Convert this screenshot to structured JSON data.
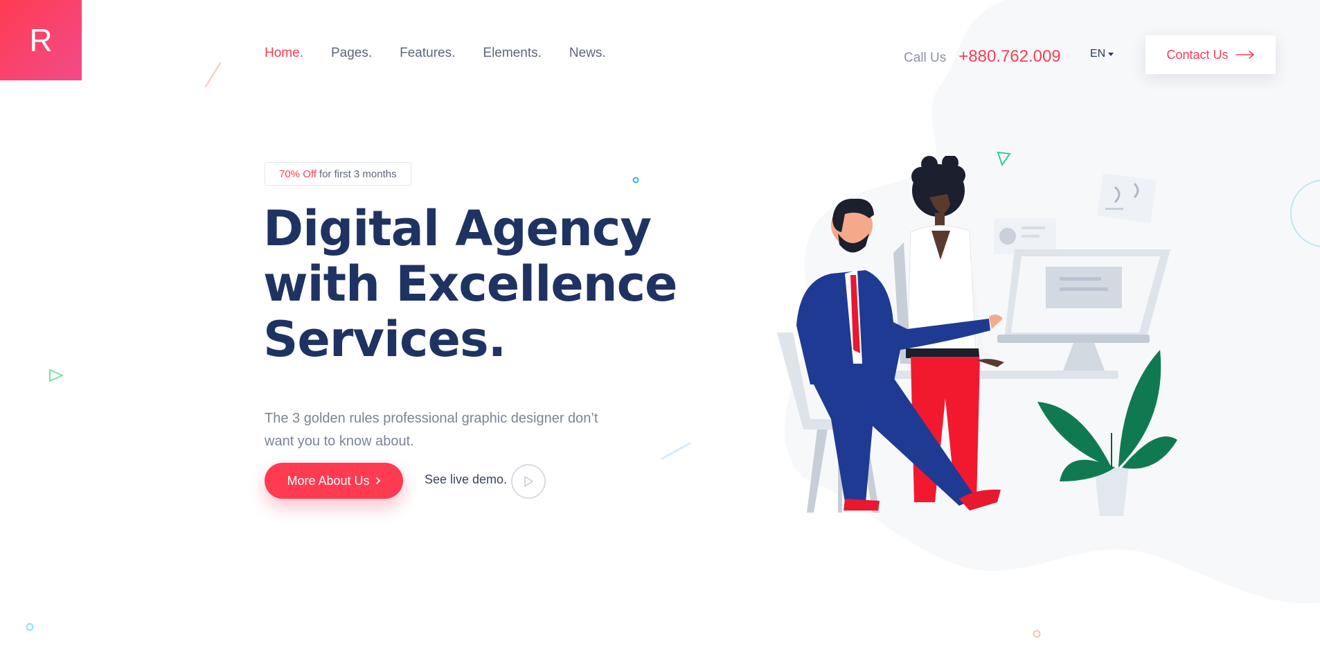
{
  "brand": {
    "logo_letter": "R",
    "accent": "#ff3b52",
    "heading_color": "#1f3363"
  },
  "nav": {
    "items": [
      {
        "label": "Home.",
        "active": true
      },
      {
        "label": "Pages.",
        "active": false
      },
      {
        "label": "Features.",
        "active": false
      },
      {
        "label": "Elements.",
        "active": false
      },
      {
        "label": "News.",
        "active": false
      }
    ]
  },
  "header": {
    "call_label": "Call Us",
    "phone": "+880.762.009",
    "language": "EN",
    "contact_label": "Contact Us",
    "contact_icon": "arrow-right-icon"
  },
  "hero": {
    "badge_off": "70% Off",
    "badge_rest": "for first 3 months",
    "title_lines": [
      "Digital Agency",
      "with Excellence",
      "Services."
    ],
    "subtext": "The 3 golden rules professional graphic designer don’t want you to know about.",
    "cta_label": "More About Us",
    "cta_icon": "chevron-right-icon",
    "demo_label": "See live demo.",
    "demo_icon": "play-icon"
  },
  "illustration": {
    "label": "office-workers-illustration"
  }
}
